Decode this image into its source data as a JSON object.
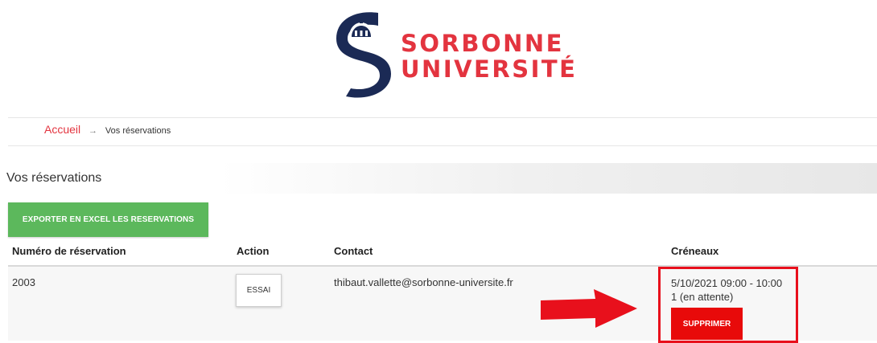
{
  "brand": {
    "line1": "SORBONNE",
    "line2": "UNIVERSITÉ",
    "navy": "#1b2a55",
    "red": "#e3343f"
  },
  "breadcrumb": {
    "home": "Accueil",
    "separator": "→",
    "current": "Vos réservations"
  },
  "section": {
    "title": "Vos réservations"
  },
  "export_button": {
    "label": "EXPORTER EN EXCEL LES RESERVATIONS",
    "color": "#5cb85c"
  },
  "table": {
    "headers": [
      "Numéro de réservation",
      "Action",
      "Contact",
      "Créneaux"
    ],
    "rows": [
      {
        "number": "2003",
        "action_label": "ESSAI",
        "contact": "thibaut.vallette@sorbonne-universite.fr",
        "slot_time": "5/10/2021 09:00 - 10:00",
        "slot_status": "1 (en attente)",
        "delete_label": "SUPPRIMER"
      }
    ]
  },
  "annotation": {
    "arrow_icon": "right-arrow-icon",
    "highlight_color": "#e8101c"
  }
}
